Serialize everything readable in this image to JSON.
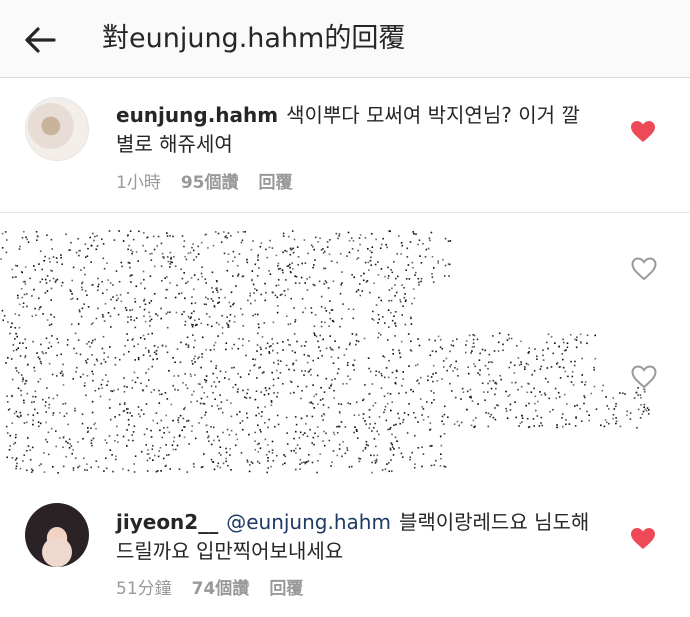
{
  "header": {
    "title": "對eunjung.hahm的回覆"
  },
  "comments": [
    {
      "username": "eunjung.hahm",
      "text": "색이뿌다 모써여 박지연님? 이거 깔",
      "text_line2": "별로 해쥬세여",
      "time": "1小時",
      "likes": "95個讚",
      "reply": "回覆",
      "liked": true
    },
    {
      "username": "jiyeon2__",
      "mention": "@eunjung.hahm",
      "text": "블랙이랑레드요 님도해",
      "text_line2": "드릴까요 입만찍어보내세요",
      "time": "51分鐘",
      "likes": "74個讚",
      "reply": "回覆",
      "liked": true
    }
  ],
  "colors": {
    "heart_liked": "#ed4956",
    "heart_outline": "#999999",
    "mention": "#1e3a64",
    "meta": "#999999"
  }
}
